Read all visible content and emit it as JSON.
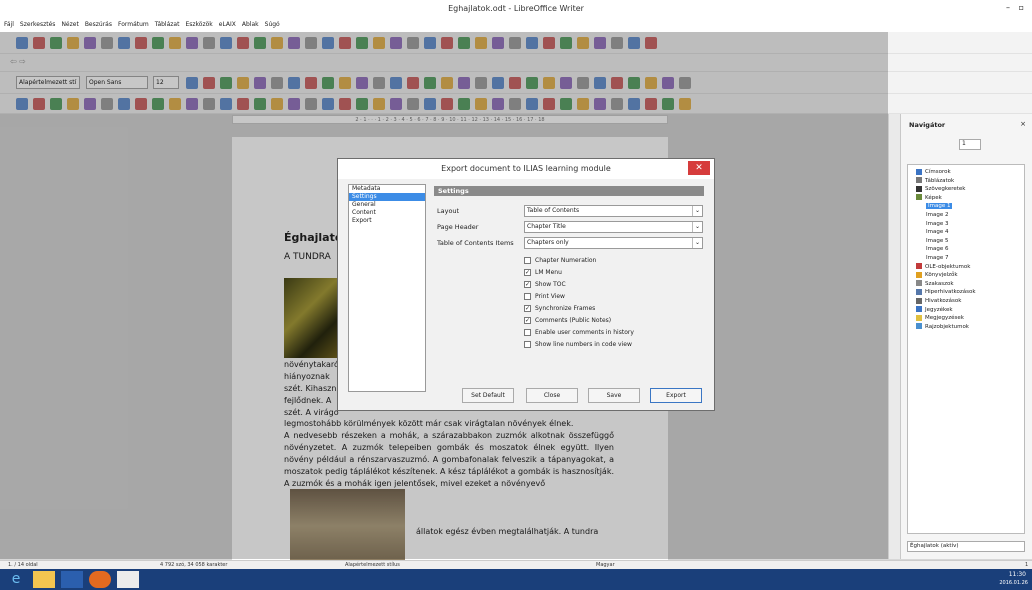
{
  "window": {
    "title": "Eghajlatok.odt - LibreOffice Writer"
  },
  "menu": [
    "Fájl",
    "Szerkesztés",
    "Nézet",
    "Beszúrás",
    "Formátum",
    "Táblázat",
    "Eszközök",
    "eLAIX",
    "Ablak",
    "Súgó"
  ],
  "formatting": {
    "style": "Alapértelmezett stí",
    "font": "Open Sans",
    "size": "12"
  },
  "document": {
    "heading": "Éghajlato",
    "sub": "A TUNDRA",
    "p1": [
      "növénytakaró",
      "hiányoznak",
      "szét. Kihaszn",
      "fejlődnek. A",
      "szét. A virágo"
    ],
    "p2": "legmostohább körülmények között már csak virágtalan növények élnek.",
    "p3": "A nedvesebb részeken a mohák, a szárazabbakon zuzmók alkotnak összefüggő növényzetet. A zuzmók telepeiben gombák és moszatok élnek együtt. Ilyen növény például a rénszarvaszuzmó. A gombafonalak felveszik a tápanyagokat, a moszatok pedig táplálékot készítenek. A kész táplálékot a gombák is hasznosítják. A zuzmók és a mohák igen jelentősek, mivel ezeket a növényevő",
    "p4": "állatok egész évben megtalálhatják. A tundra"
  },
  "dialog": {
    "title": "Export document to ILIAS learning module",
    "list": [
      "Metadata",
      "Settings",
      "General",
      "Content",
      "Export"
    ],
    "selected": 1,
    "section": "Settings",
    "fields": [
      {
        "label": "Layout",
        "value": "Table of Contents"
      },
      {
        "label": "Page Header",
        "value": "Chapter Title"
      },
      {
        "label": "Table of Contents Items",
        "value": "Chapters only"
      }
    ],
    "checks": [
      {
        "label": "Chapter Numeration",
        "checked": false
      },
      {
        "label": "LM Menu",
        "checked": true
      },
      {
        "label": "Show TOC",
        "checked": true
      },
      {
        "label": "Print View",
        "checked": false
      },
      {
        "label": "Synchronize Frames",
        "checked": true
      },
      {
        "label": "Comments (Public Notes)",
        "checked": true
      },
      {
        "label": "Enable user comments in history",
        "checked": false
      },
      {
        "label": "Show line numbers in code view",
        "checked": false
      }
    ],
    "buttons": {
      "setdefault": "Set Default",
      "close": "Close",
      "save": "Save",
      "export": "Export"
    }
  },
  "navigator": {
    "title": "Navigátor",
    "page": "1",
    "items": [
      {
        "label": "Címsorok",
        "level": 0
      },
      {
        "label": "Táblázatok",
        "level": 0
      },
      {
        "label": "Szövegkeretek",
        "level": 0
      },
      {
        "label": "Képek",
        "level": 0
      },
      {
        "label": "Image 1",
        "level": 1,
        "sel": true
      },
      {
        "label": "Image 2",
        "level": 1
      },
      {
        "label": "Image 3",
        "level": 1
      },
      {
        "label": "Image 4",
        "level": 1
      },
      {
        "label": "Image 5",
        "level": 1
      },
      {
        "label": "Image 6",
        "level": 1
      },
      {
        "label": "Image 7",
        "level": 1
      },
      {
        "label": "OLE-objektumok",
        "level": 0
      },
      {
        "label": "Könyvjelzők",
        "level": 0
      },
      {
        "label": "Szakaszok",
        "level": 0
      },
      {
        "label": "Hiperhivatkozások",
        "level": 0
      },
      {
        "label": "Hivatkozások",
        "level": 0
      },
      {
        "label": "Jegyzékek",
        "level": 0
      },
      {
        "label": "Megjegyzések",
        "level": 0
      },
      {
        "label": "Rajzobjektumok",
        "level": 0
      }
    ],
    "doc": "Éghajlatok (aktív)"
  },
  "statusbar": {
    "page": "1. / 14 oldal",
    "words": "4 792 szó, 34 058 karakter",
    "style": "Alapértelmezett stílus",
    "lang": "Magyar",
    "zoom": "1"
  },
  "clock": {
    "time": "11:30",
    "date": "2016.01.26"
  }
}
